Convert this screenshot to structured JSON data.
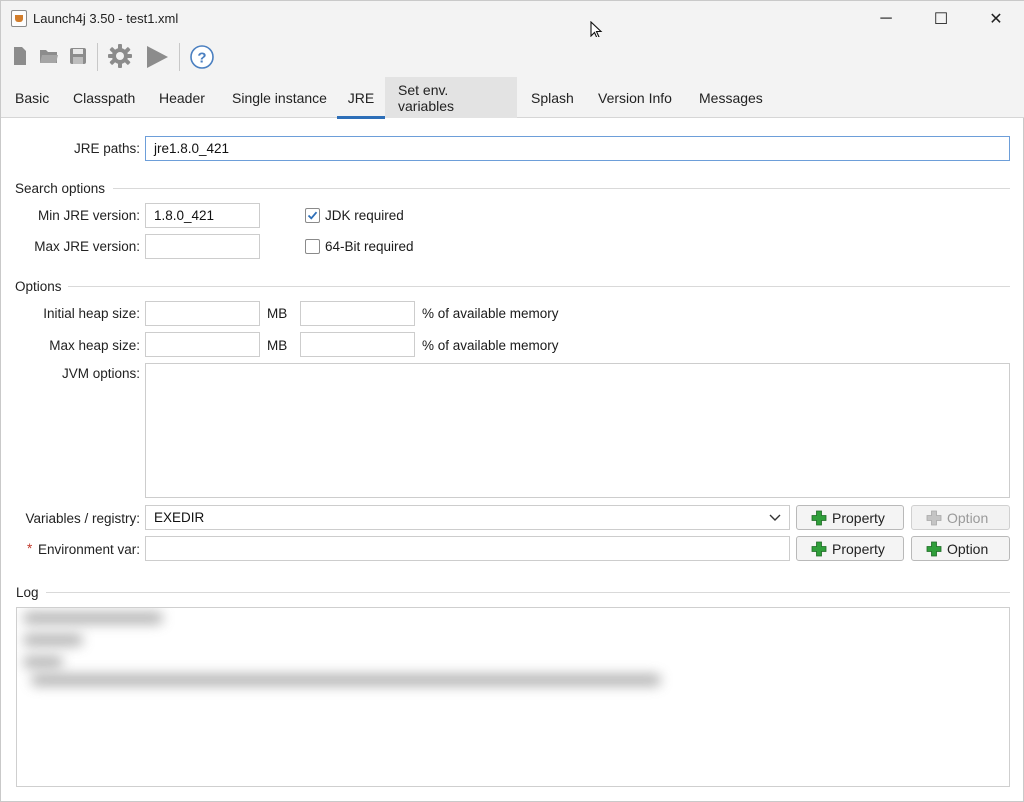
{
  "window": {
    "title": "Launch4j 3.50 - test1.xml",
    "controls": {
      "minimize": "─",
      "maximize": "☐",
      "close": "✕"
    }
  },
  "toolbar": {
    "icons": [
      "new-file-icon",
      "open-folder-icon",
      "save-icon",
      "build-gear-icon",
      "run-play-icon",
      "help-icon"
    ]
  },
  "tabs": [
    {
      "label": "Basic"
    },
    {
      "label": "Classpath"
    },
    {
      "label": "Header"
    },
    {
      "label": "Single instance"
    },
    {
      "label": "JRE"
    },
    {
      "label": "Set env. variables"
    },
    {
      "label": "Splash"
    },
    {
      "label": "Version Info"
    },
    {
      "label": "Messages"
    }
  ],
  "active_tab": "JRE",
  "jre": {
    "paths_label": "JRE paths:",
    "paths_value": "jre1.8.0_421",
    "search_options": "Search options",
    "min_label": "Min JRE version:",
    "min_value": "1.8.0_421",
    "max_label": "Max JRE version:",
    "max_value": "",
    "jdk_required": "JDK required",
    "jdk_checked": true,
    "bit64_required": "64-Bit required",
    "bit64_checked": false
  },
  "options": {
    "title": "Options",
    "initial_heap_label": "Initial heap size:",
    "max_heap_label": "Max heap size:",
    "mb": "MB",
    "percent_label": "% of available memory",
    "jvm_label": "JVM options:",
    "vars_label": "Variables / registry:",
    "vars_value": "EXEDIR",
    "required_marker": "*",
    "env_label": "Environment var:",
    "property_button": "Property",
    "option_button": "Option"
  },
  "log": {
    "title": "Log"
  },
  "colors": {
    "accent": "#2e6fb8",
    "plus_green": "#2f9e3a"
  }
}
